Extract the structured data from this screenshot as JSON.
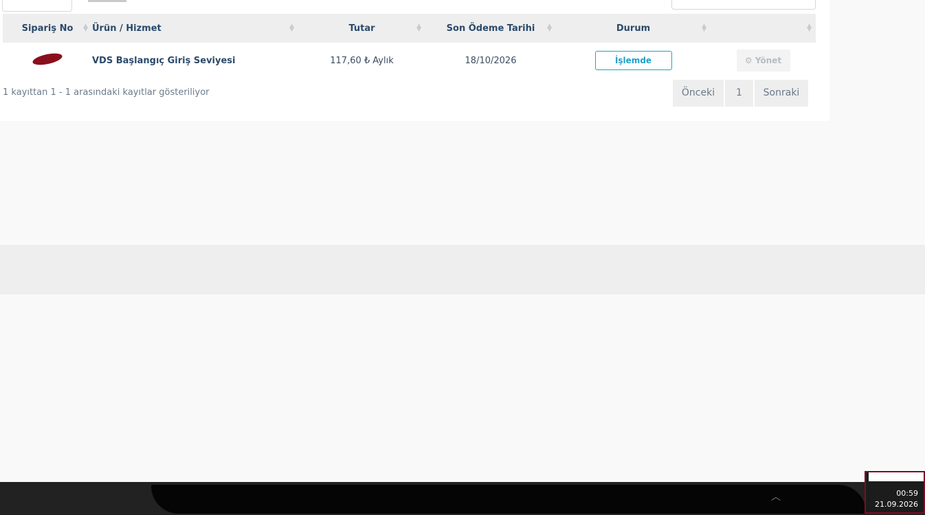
{
  "table": {
    "headers": [
      "Sipariş No",
      "Ürün / Hizmet",
      "Tutar",
      "Son Ödeme Tarihi",
      "Durum",
      ""
    ],
    "rows": [
      {
        "order_no": "",
        "product": "VDS Başlangıç Giriş Seviyesi",
        "amount": "117,60 ₺ Aylık",
        "due_date": "18/10/2026",
        "status": "İşlemde",
        "action": "Yönet",
        "action_icon": "gear-icon"
      }
    ]
  },
  "info_text": "1 kayıttan 1 - 1 arasındaki kayıtlar gösteriliyor",
  "pagination": {
    "previous": "Önceki",
    "current": "1",
    "next": "Sonraki"
  },
  "taskbar": {
    "clock_time": "00:59",
    "clock_date": "21.09.2026"
  },
  "colors": {
    "accent": "#1ea1c9",
    "header_text": "#2b4a6b",
    "highlight_border": "#7b0e21",
    "redaction": "#8a0f1c"
  }
}
